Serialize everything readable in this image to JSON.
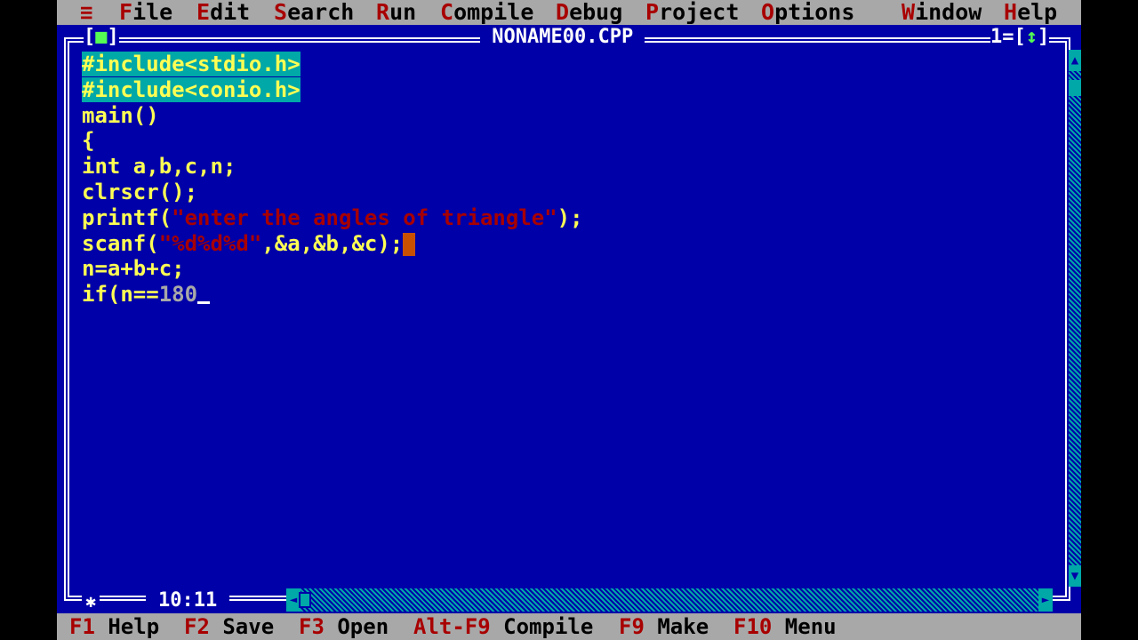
{
  "menu": {
    "system": "≡",
    "items": [
      {
        "hotkey": "F",
        "rest": "ile"
      },
      {
        "hotkey": "E",
        "rest": "dit"
      },
      {
        "hotkey": "S",
        "rest": "earch"
      },
      {
        "hotkey": "R",
        "rest": "un"
      },
      {
        "hotkey": "C",
        "rest": "ompile"
      },
      {
        "hotkey": "D",
        "rest": "ebug"
      },
      {
        "hotkey": "P",
        "rest": "roject"
      },
      {
        "hotkey": "O",
        "rest": "ptions"
      },
      {
        "hotkey": "W",
        "rest": "indow"
      },
      {
        "hotkey": "H",
        "rest": "elp"
      }
    ]
  },
  "window": {
    "title": " NONAME00.CPP ",
    "close_left": "[",
    "close_mark": "■",
    "close_right": "]",
    "number": "1=[",
    "zoom_mark": "↕",
    "number_end": "]",
    "cursor_position": "10:11",
    "resize_icon": "✱"
  },
  "code": {
    "l1": "#include<stdio.h>",
    "l2": "#include<conio.h>",
    "l3": "main()",
    "l4": "{",
    "l5": "int a,b,c,n;",
    "l6": "clrscr();",
    "l7_pre": "printf(",
    "l7_str": "\"enter the angles of triangle\"",
    "l7_post": ");",
    "l8_pre": "scanf(",
    "l8_str": "\"%d%d%d\"",
    "l8_post": ",&a,&b,&c);",
    "l9": "n=a+b+c;",
    "l10_pre": "if(n==",
    "l10_num": "180"
  },
  "status": {
    "items": [
      {
        "key": "F1",
        "label": " Help"
      },
      {
        "key": "F2",
        "label": " Save"
      },
      {
        "key": "F3",
        "label": " Open"
      },
      {
        "key": "Alt-F9",
        "label": " Compile"
      },
      {
        "key": "F9",
        "label": " Make"
      },
      {
        "key": "F10",
        "label": " Menu"
      }
    ]
  },
  "colors": {
    "background": "#0000a8",
    "menu_bg": "#a8a8a8",
    "hotkey": "#a80000",
    "code_text": "#fefe54",
    "selection": "#00a8a8"
  }
}
